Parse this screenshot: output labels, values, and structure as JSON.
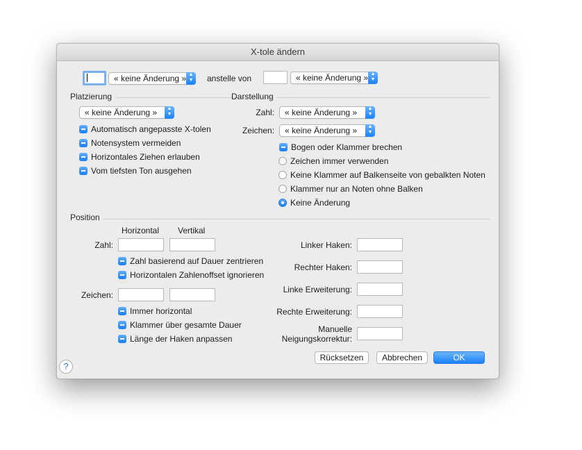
{
  "window": {
    "title": "X-tole ändern"
  },
  "top": {
    "popup_left": "« keine Änderung »",
    "instead_label": "anstelle von",
    "popup_right": "« keine Änderung »"
  },
  "placement": {
    "title": "Platzierung",
    "popup": "« keine Änderung »",
    "checks": [
      "Automatisch angepasste X-tolen",
      "Notensystem vermeiden",
      "Horizontales Ziehen erlauben",
      "Vom tiefsten Ton ausgehen"
    ]
  },
  "display": {
    "title": "Darstellung",
    "number_label": "Zahl:",
    "number_popup": "« keine Änderung »",
    "sign_label": "Zeichen:",
    "sign_popup": "« keine Änderung »",
    "break_check": "Bogen oder Klammer brechen",
    "radios": [
      "Zeichen immer verwenden",
      "Keine Klammer auf Balkenseite von gebalkten Noten",
      "Klammer nur an Noten ohne Balken",
      "Keine Änderung"
    ]
  },
  "position": {
    "title": "Position",
    "col_horizontal": "Horizontal",
    "col_vertical": "Vertikal",
    "number_label": "Zahl:",
    "number_checks": [
      "Zahl basierend auf Dauer zentrieren",
      "Horizontalen Zahlenoffset ignorieren"
    ],
    "sign_label": "Zeichen:",
    "sign_checks": [
      "Immer horizontal",
      "Klammer über gesamte Dauer",
      "Länge der Haken anpassen"
    ],
    "left_hook": "Linker Haken:",
    "right_hook": "Rechter Haken:",
    "left_ext": "Linke Erweiterung:",
    "right_ext": "Rechte Erweiterung:",
    "manual_slope_1": "Manuelle",
    "manual_slope_2": "Neigungskorrektur:"
  },
  "buttons": {
    "reset": "Rücksetzen",
    "cancel": "Abbrechen",
    "ok": "OK",
    "help": "?"
  }
}
